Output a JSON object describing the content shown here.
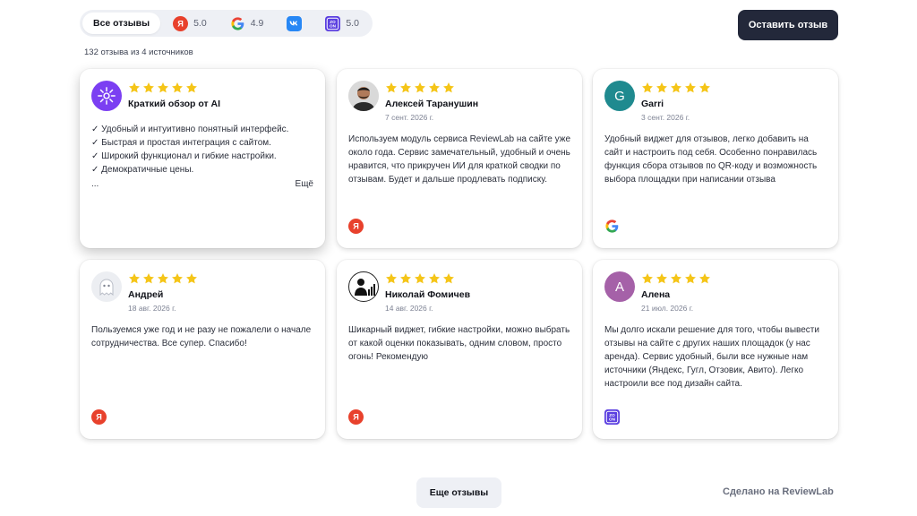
{
  "tabs": [
    {
      "label": "Все отзывы",
      "icon": "none"
    },
    {
      "rating": "5.0",
      "icon": "yandex-icon"
    },
    {
      "rating": "4.9",
      "icon": "google-icon"
    },
    {
      "rating": "",
      "icon": "vk-icon"
    },
    {
      "rating": "5.0",
      "icon": "otzovik-icon"
    }
  ],
  "header": {
    "leave_review_label": "Оставить отзыв",
    "count_text": "132 отзыва из 4 источников"
  },
  "colors": {
    "accent_dark": "#23283a",
    "star": "#f5c518",
    "ai_avatar": "#7b3ff2",
    "garri_avatar": "#1f8a8f",
    "alena_avatar": "#a561a8",
    "yandex": "#e8412c",
    "vk": "#2787f5",
    "otzovik": "#5b3fe0"
  },
  "ai_summary": {
    "title": "Краткий обзор от AI",
    "rating": 5,
    "points": [
      "✓ Удобный и интуитивно понятный интерфейс.",
      "✓ Быстрая и простая интеграция с сайтом.",
      "✓ Широкий функционал и гибкие настройки.",
      "✓ Демократичные цены."
    ],
    "ellipsis": "...",
    "more_label": "Ещё"
  },
  "reviews": [
    {
      "name": "Алексей Таранушин",
      "date": "7 сент. 2026 г.",
      "rating": 5,
      "text": "Используем модуль сервиса ReviewLab на сайте уже около года. Сервис замечательный, удобный и очень нравится, что прикручен ИИ для краткой сводки по отзывам. Будет и дальше продлевать подписку.",
      "source": "yandex-icon",
      "avatar": "photo"
    },
    {
      "name": "Garri",
      "date": "3 сент. 2026 г.",
      "rating": 5,
      "text": "Удобный виджет для отзывов, легко добавить на сайт и настроить под себя. Особенно понравилась функция сбора отзывов по QR-коду и возможность выбора площадки при написании отзыва",
      "source": "google-icon",
      "avatar_letter": "G"
    },
    {
      "name": "Андрей",
      "date": "18 авг. 2026 г.",
      "rating": 5,
      "text": "Пользуемся уже год и не разу не пожалели о начале сотрудничества. Все супер. Спасибо!",
      "source": "yandex-icon",
      "avatar": "ghost"
    },
    {
      "name": "Николай Фомичев",
      "date": "14 авг. 2026 г.",
      "rating": 5,
      "text": "Шикарный виджет, гибкие настройки, можно выбрать от какой оценки показывать, одним словом, просто огонь! Рекомендую",
      "source": "yandex-icon",
      "avatar": "logo"
    },
    {
      "name": "Алена",
      "date": "21 июл. 2026 г.",
      "rating": 5,
      "text": "Мы долго искали решение для того, чтобы вывести отзывы на сайте с других наших площадок (у нас аренда). Сервис удобный, были все нужные нам источники (Яндекс, Гугл, Отзовик, Авито). Легко настроили все под дизайн сайта.",
      "source": "otzovik-icon",
      "avatar_letter": "А"
    }
  ],
  "footer": {
    "more_reviews_label": "Еще отзывы",
    "made_by": "Сделано на ReviewLab"
  }
}
